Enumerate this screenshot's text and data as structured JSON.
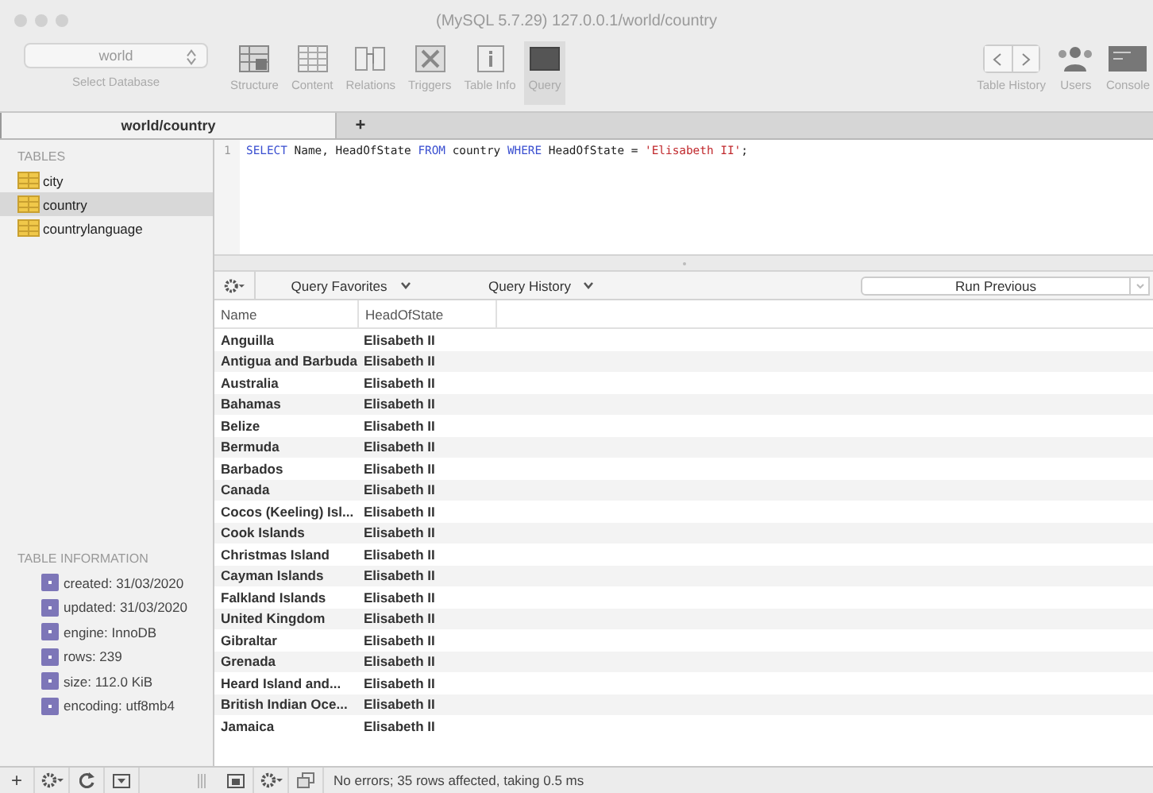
{
  "window": {
    "title": "(MySQL 5.7.29) 127.0.0.1/world/country"
  },
  "database_selector": {
    "value": "world",
    "label": "Select Database"
  },
  "toolbar": [
    {
      "label": "Structure",
      "selected": false
    },
    {
      "label": "Content",
      "selected": false
    },
    {
      "label": "Relations",
      "selected": false
    },
    {
      "label": "Triggers",
      "selected": false
    },
    {
      "label": "Table Info",
      "selected": false
    },
    {
      "label": "Query",
      "selected": true
    }
  ],
  "toolbar_right": [
    {
      "label": "Table History",
      "kind": "history"
    },
    {
      "label": "Users",
      "kind": "users"
    },
    {
      "label": "Console",
      "kind": "console"
    }
  ],
  "tabs": [
    {
      "label": "world/country",
      "selected": true
    },
    {
      "label": "+",
      "selected": false
    }
  ],
  "sidebar": {
    "tables_heading": "TABLES",
    "tables": [
      {
        "name": "city",
        "selected": false
      },
      {
        "name": "country",
        "selected": true
      },
      {
        "name": "countrylanguage",
        "selected": false
      }
    ],
    "info_heading": "TABLE INFORMATION",
    "info": [
      "created: 31/03/2020",
      "updated: 31/03/2020",
      "engine: InnoDB",
      "rows: 239",
      "size: 112.0 KiB",
      "encoding: utf8mb4"
    ]
  },
  "editor": {
    "line_number": "1",
    "tokens": [
      {
        "text": "SELECT",
        "kind": "keyword"
      },
      {
        "text": " Name, HeadOfState ",
        "kind": "plain"
      },
      {
        "text": "FROM",
        "kind": "keyword"
      },
      {
        "text": " country ",
        "kind": "plain"
      },
      {
        "text": "WHERE",
        "kind": "keyword"
      },
      {
        "text": " HeadOfState = ",
        "kind": "plain"
      },
      {
        "text": "'Elisabeth II'",
        "kind": "string"
      },
      {
        "text": ";",
        "kind": "plain"
      }
    ]
  },
  "query_bar": {
    "favorites": "Query Favorites",
    "history": "Query History",
    "run": "Run Previous"
  },
  "table": {
    "columns": [
      "Name",
      "HeadOfState"
    ],
    "rows": [
      [
        "Anguilla",
        "Elisabeth II"
      ],
      [
        "Antigua and Barbuda",
        "Elisabeth II"
      ],
      [
        "Australia",
        "Elisabeth II"
      ],
      [
        "Bahamas",
        "Elisabeth II"
      ],
      [
        "Belize",
        "Elisabeth II"
      ],
      [
        "Bermuda",
        "Elisabeth II"
      ],
      [
        "Barbados",
        "Elisabeth II"
      ],
      [
        "Canada",
        "Elisabeth II"
      ],
      [
        "Cocos (Keeling) Isl...",
        "Elisabeth II"
      ],
      [
        "Cook Islands",
        "Elisabeth II"
      ],
      [
        "Christmas Island",
        "Elisabeth II"
      ],
      [
        "Cayman Islands",
        "Elisabeth II"
      ],
      [
        "Falkland Islands",
        "Elisabeth II"
      ],
      [
        "United Kingdom",
        "Elisabeth II"
      ],
      [
        "Gibraltar",
        "Elisabeth II"
      ],
      [
        "Grenada",
        "Elisabeth II"
      ],
      [
        "Heard Island and...",
        "Elisabeth II"
      ],
      [
        "British Indian Oce...",
        "Elisabeth II"
      ],
      [
        "Jamaica",
        "Elisabeth II"
      ]
    ]
  },
  "status_bar": {
    "add": "+",
    "message": "No errors; 35 rows affected, taking 0.5 ms"
  }
}
